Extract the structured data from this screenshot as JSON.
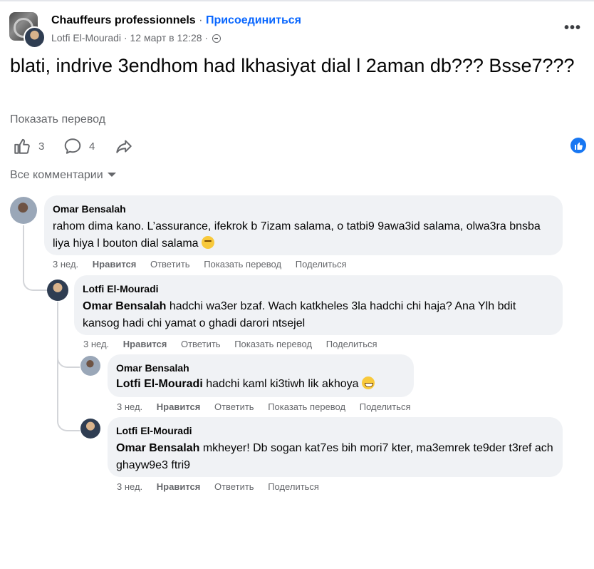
{
  "header": {
    "group_name": "Chauffeurs professionnels",
    "separator": "·",
    "join_label": "Присоединиться",
    "author": "Lotfi El-Mouradi",
    "timestamp": "12 март в 12:28",
    "more_label": "•••"
  },
  "post": {
    "text": "blati, indrive 3endhom had lkhasiyat dial l 2aman db??? Bsse7???",
    "translate_label": "Показать перевод"
  },
  "actions": {
    "likes_count": "3",
    "comments_count": "4"
  },
  "comments_filter": "Все комментарии",
  "comments": [
    {
      "author": "Omar Bensalah",
      "mention": "",
      "text": "rahom dima kano. L’assurance, ifekrok b 7izam salama, o tatbi9 9awa3id salama, olwa3ra bnsba liya hiya l bouton dial salama",
      "time": "3 нед.",
      "like": "Нравится",
      "reply": "Ответить",
      "translate": "Показать перевод",
      "share": "Поделиться"
    },
    {
      "author": "Lotfi El-Mouradi",
      "mention": "Omar Bensalah",
      "text": " hadchi wa3er bzaf. Wach katkheles 3la hadchi chi haja? Ana Ylh bdit kansog hadi chi yamat o ghadi darori ntsejel",
      "time": "3 нед.",
      "like": "Нравится",
      "reply": "Ответить",
      "translate": "Показать перевод",
      "share": "Поделиться"
    },
    {
      "author": "Omar Bensalah",
      "mention": "Lotfi El-Mouradi",
      "text": " hadchi kaml ki3tiwh lik akhoya",
      "time": "3 нед.",
      "like": "Нравится",
      "reply": "Ответить",
      "translate": "Показать перевод",
      "share": "Поделиться"
    },
    {
      "author": "Lotfi El-Mouradi",
      "mention": "Omar Bensalah",
      "text": " mkheyer! Db sogan kat7es bih mori7 kter, ma3emrek te9der t3ref ach ghayw9e3 ftri9",
      "time": "3 нед.",
      "like": "Нравится",
      "reply": "Ответить",
      "translate": "",
      "share": "Поделиться"
    }
  ],
  "colors": {
    "link_blue": "#0866ff",
    "muted": "#65676b",
    "bubble": "#f0f2f5",
    "like_badge": "#1877f2"
  },
  "icons": [
    "group-cover-icon",
    "globe-icon",
    "more-dots-icon",
    "like-thumb-icon",
    "comment-icon",
    "share-arrow-icon",
    "like-badge-icon",
    "caret-down-icon",
    "relieved-emoji-icon",
    "grin-emoji-icon"
  ]
}
